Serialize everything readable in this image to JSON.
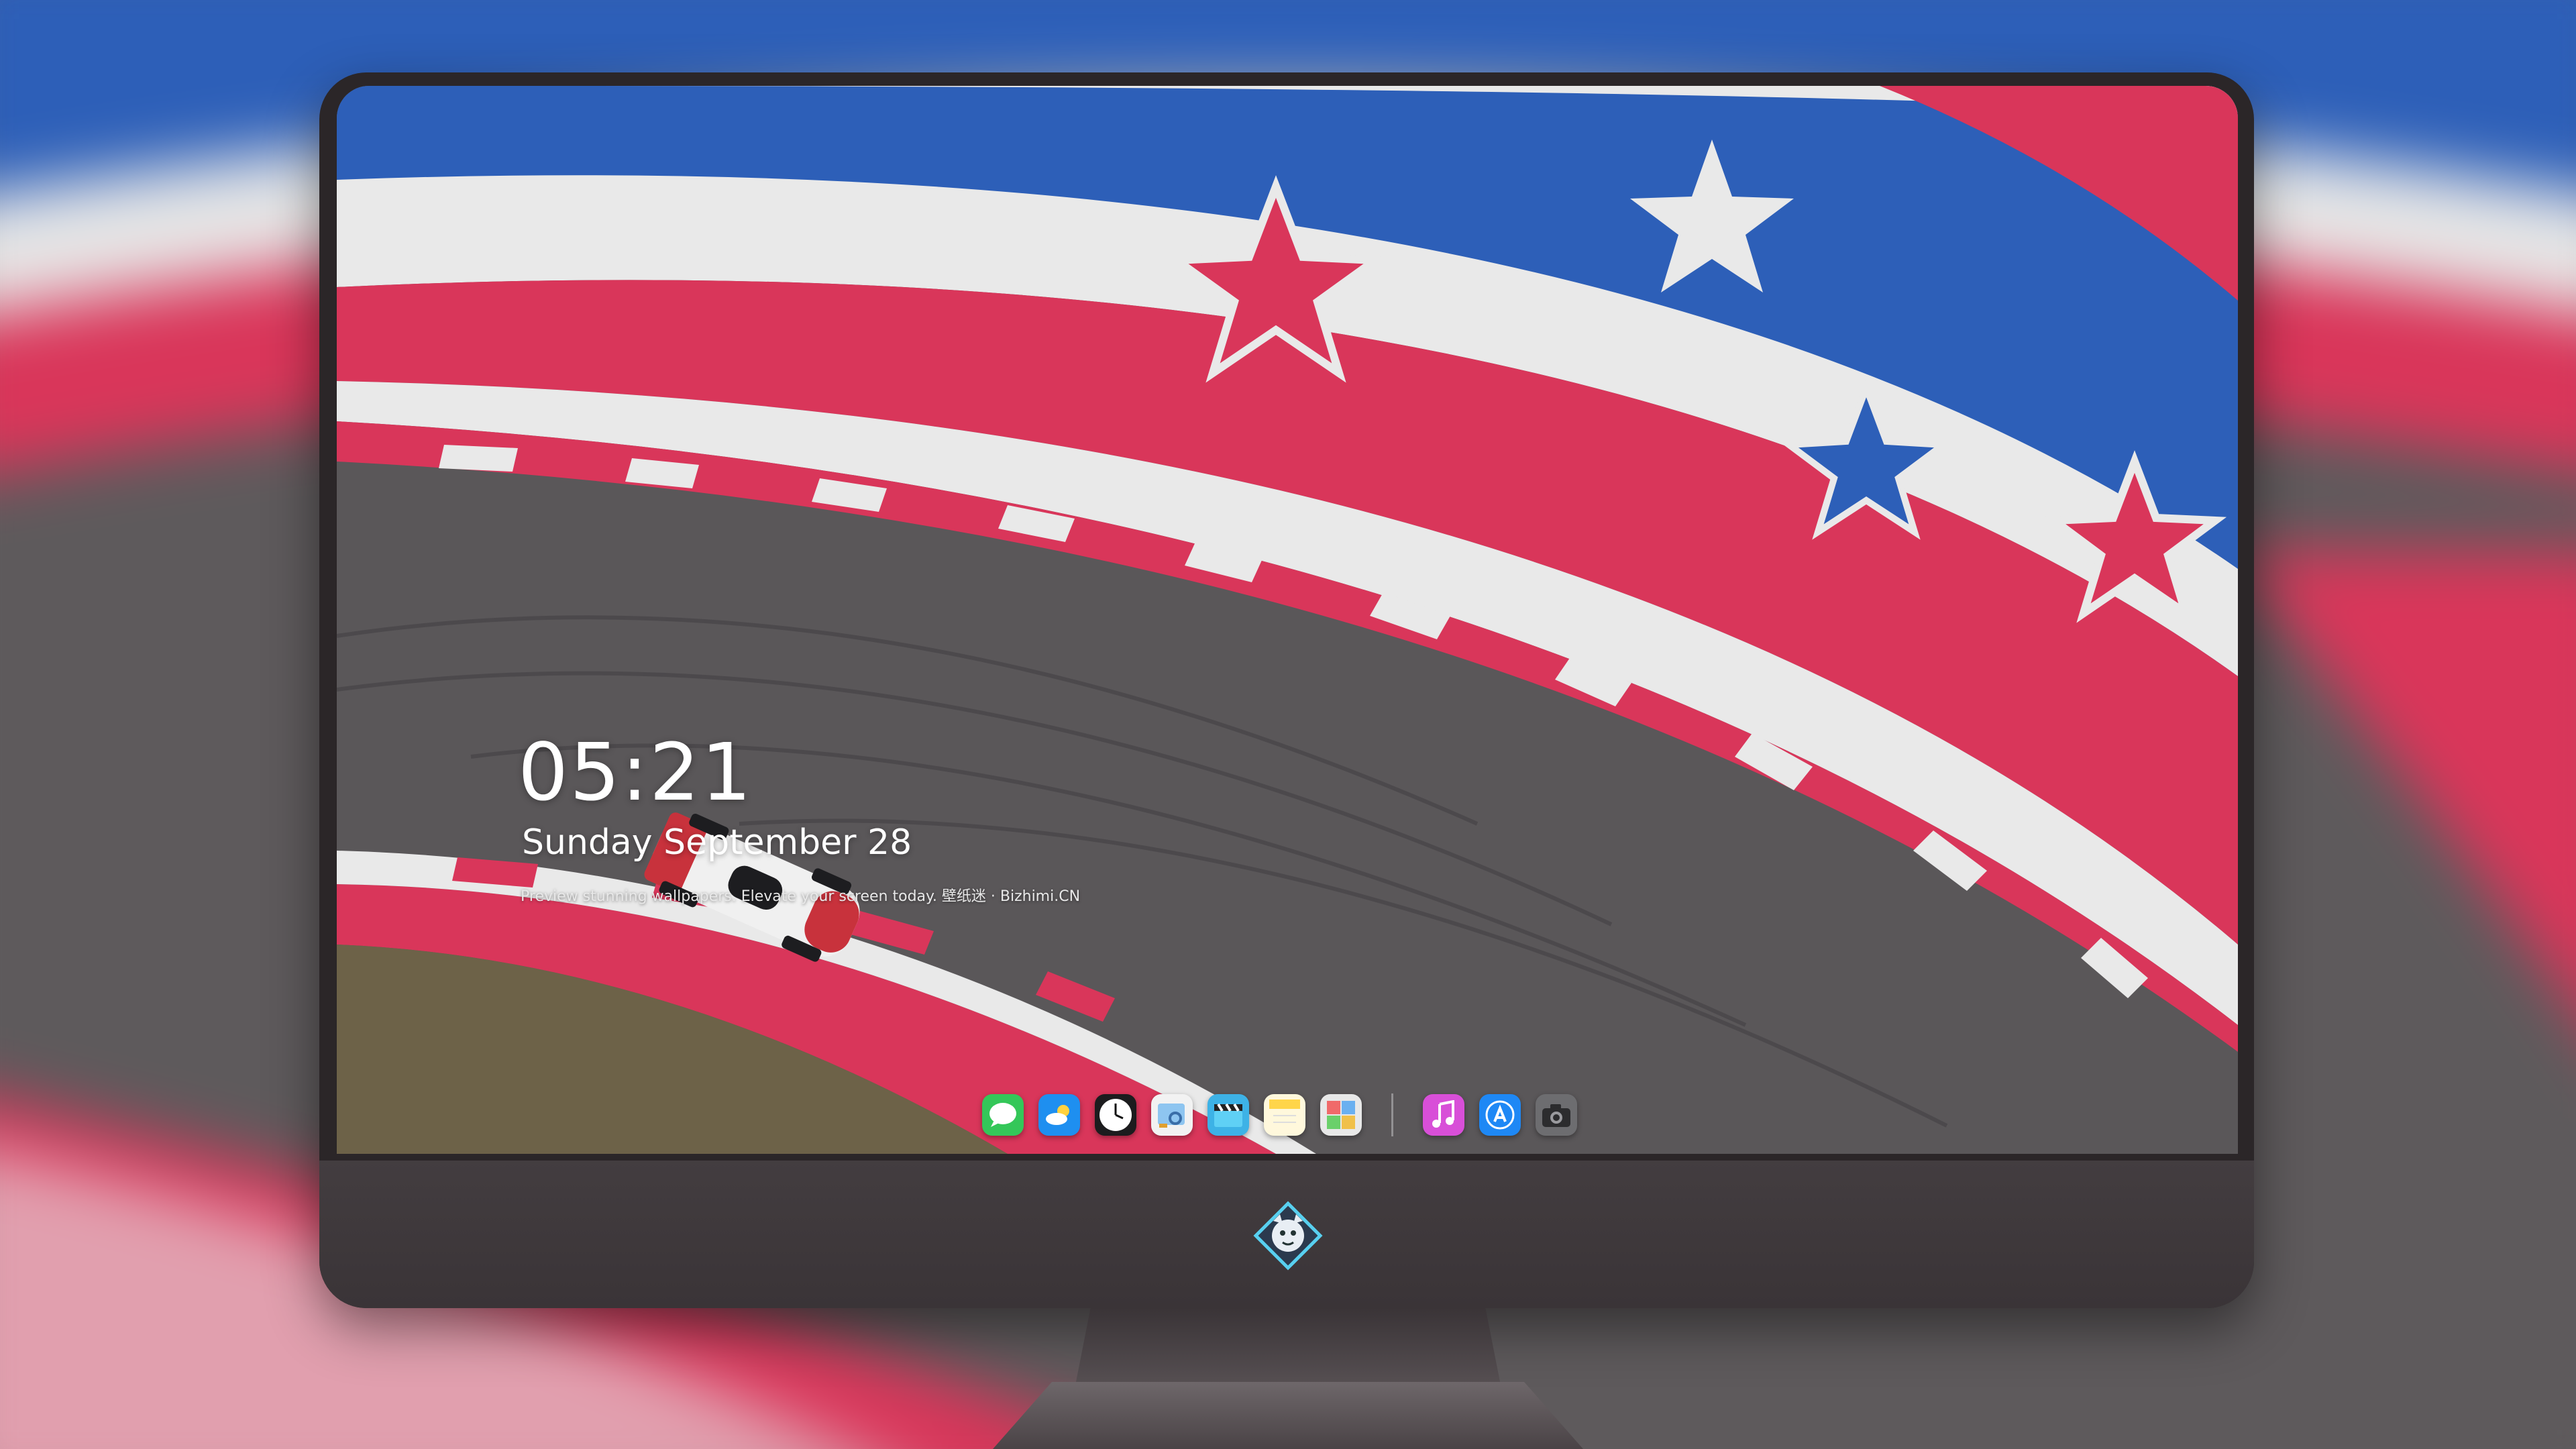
{
  "lockscreen": {
    "time": "05:21",
    "date": "Sunday September 28",
    "tagline": "Preview stunning wallpapers. Elevate your screen today. 壁纸迷 · Bizhimi.CN"
  },
  "dock": {
    "items": [
      {
        "name": "messages",
        "icon": "messages-icon",
        "color": "#34c759"
      },
      {
        "name": "weather",
        "icon": "weather-icon",
        "color": "#1e8ff0"
      },
      {
        "name": "clock",
        "icon": "clock-icon",
        "color": "#1c1c1e"
      },
      {
        "name": "preview",
        "icon": "preview-icon",
        "color": "#f2f2f2"
      },
      {
        "name": "clips",
        "icon": "clapperboard-icon",
        "color": "#3db2e6"
      },
      {
        "name": "notes",
        "icon": "notes-icon",
        "color": "#ffd54a"
      },
      {
        "name": "photo-booth",
        "icon": "photo-booth-icon",
        "color": "#e8e8e8"
      },
      {
        "name": "music",
        "icon": "music-icon",
        "color": "#d84fd8"
      },
      {
        "name": "app-store",
        "icon": "app-store-icon",
        "color": "#1e88f5"
      },
      {
        "name": "camera",
        "icon": "camera-icon",
        "color": "#6d6d70"
      }
    ]
  },
  "colors": {
    "track_red": "#d9365a",
    "track_white": "#e9e9e9",
    "track_blue": "#2d5fb8",
    "asphalt": "#5a5759",
    "bezel": "#2b2628"
  }
}
